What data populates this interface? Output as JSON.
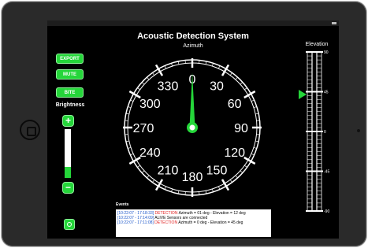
{
  "app": {
    "title": "Acoustic Detection System",
    "azimuth_label": "Azimuth",
    "elevation_label": "Elevation"
  },
  "buttons": {
    "export": "EXPORT",
    "mute": "MUTE",
    "bite": "BITE",
    "plus": "+",
    "minus": "−"
  },
  "brightness": {
    "label": "Brightness",
    "level_fraction": 0.22
  },
  "gauge": {
    "labels": [
      "0",
      "30",
      "60",
      "90",
      "120",
      "150",
      "180",
      "210",
      "240",
      "270",
      "300",
      "330"
    ],
    "needle_azimuth_deg": 0
  },
  "elevation": {
    "ticks": [
      "90",
      "45",
      "0",
      "-45",
      "-90"
    ],
    "marker_deg": 45
  },
  "events": {
    "label": "Events",
    "items": [
      {
        "time": "[10:22:07 - 17:18:33]",
        "kind": "DETECTION",
        "text": "Azimuth = 01 deg - Elevation = 12 deg"
      },
      {
        "time": "[10:22:07 - 17:14:09]",
        "kind": "ALIVE",
        "text": "Sensors are connected"
      },
      {
        "time": "[10:22:07 - 17:11:08]",
        "kind": "DETECTION",
        "text": "Azimuth = 0 deg - Elevation = 45 deg"
      }
    ]
  },
  "colors": {
    "accent": "#25d63a",
    "timestamp": "#1a55c9",
    "detection": "#e02020"
  }
}
